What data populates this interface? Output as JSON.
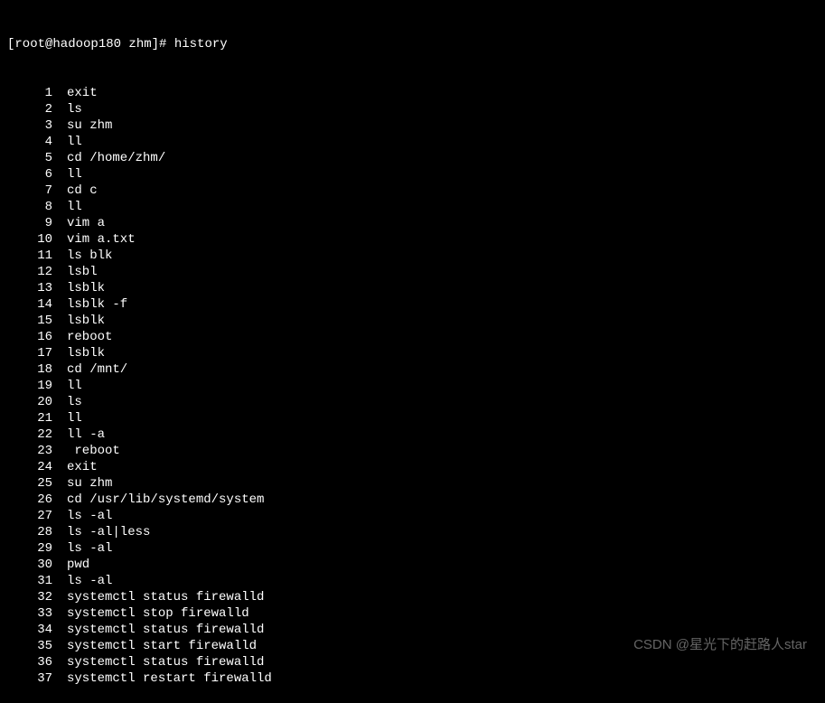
{
  "prompt": "[root@hadoop180 zhm]# ",
  "command": "history",
  "history": [
    {
      "num": "1",
      "cmd": "exit"
    },
    {
      "num": "2",
      "cmd": "ls"
    },
    {
      "num": "3",
      "cmd": "su zhm"
    },
    {
      "num": "4",
      "cmd": "ll"
    },
    {
      "num": "5",
      "cmd": "cd /home/zhm/"
    },
    {
      "num": "6",
      "cmd": "ll"
    },
    {
      "num": "7",
      "cmd": "cd c"
    },
    {
      "num": "8",
      "cmd": "ll"
    },
    {
      "num": "9",
      "cmd": "vim a"
    },
    {
      "num": "10",
      "cmd": "vim a.txt"
    },
    {
      "num": "11",
      "cmd": "ls blk"
    },
    {
      "num": "12",
      "cmd": "lsbl"
    },
    {
      "num": "13",
      "cmd": "lsblk"
    },
    {
      "num": "14",
      "cmd": "lsblk -f"
    },
    {
      "num": "15",
      "cmd": "lsblk"
    },
    {
      "num": "16",
      "cmd": "reboot"
    },
    {
      "num": "17",
      "cmd": "lsblk"
    },
    {
      "num": "18",
      "cmd": "cd /mnt/"
    },
    {
      "num": "19",
      "cmd": "ll"
    },
    {
      "num": "20",
      "cmd": "ls"
    },
    {
      "num": "21",
      "cmd": "ll"
    },
    {
      "num": "22",
      "cmd": "ll -a"
    },
    {
      "num": "23",
      "cmd": " reboot"
    },
    {
      "num": "24",
      "cmd": "exit"
    },
    {
      "num": "25",
      "cmd": "su zhm"
    },
    {
      "num": "26",
      "cmd": "cd /usr/lib/systemd/system"
    },
    {
      "num": "27",
      "cmd": "ls -al"
    },
    {
      "num": "28",
      "cmd": "ls -al|less"
    },
    {
      "num": "29",
      "cmd": "ls -al"
    },
    {
      "num": "30",
      "cmd": "pwd"
    },
    {
      "num": "31",
      "cmd": "ls -al"
    },
    {
      "num": "32",
      "cmd": "systemctl status firewalld"
    },
    {
      "num": "33",
      "cmd": "systemctl stop firewalld"
    },
    {
      "num": "34",
      "cmd": "systemctl status firewalld"
    },
    {
      "num": "35",
      "cmd": "systemctl start firewalld"
    },
    {
      "num": "36",
      "cmd": "systemctl status firewalld"
    },
    {
      "num": "37",
      "cmd": "systemctl restart firewalld"
    }
  ],
  "watermark": "CSDN @星光下的赶路人star"
}
